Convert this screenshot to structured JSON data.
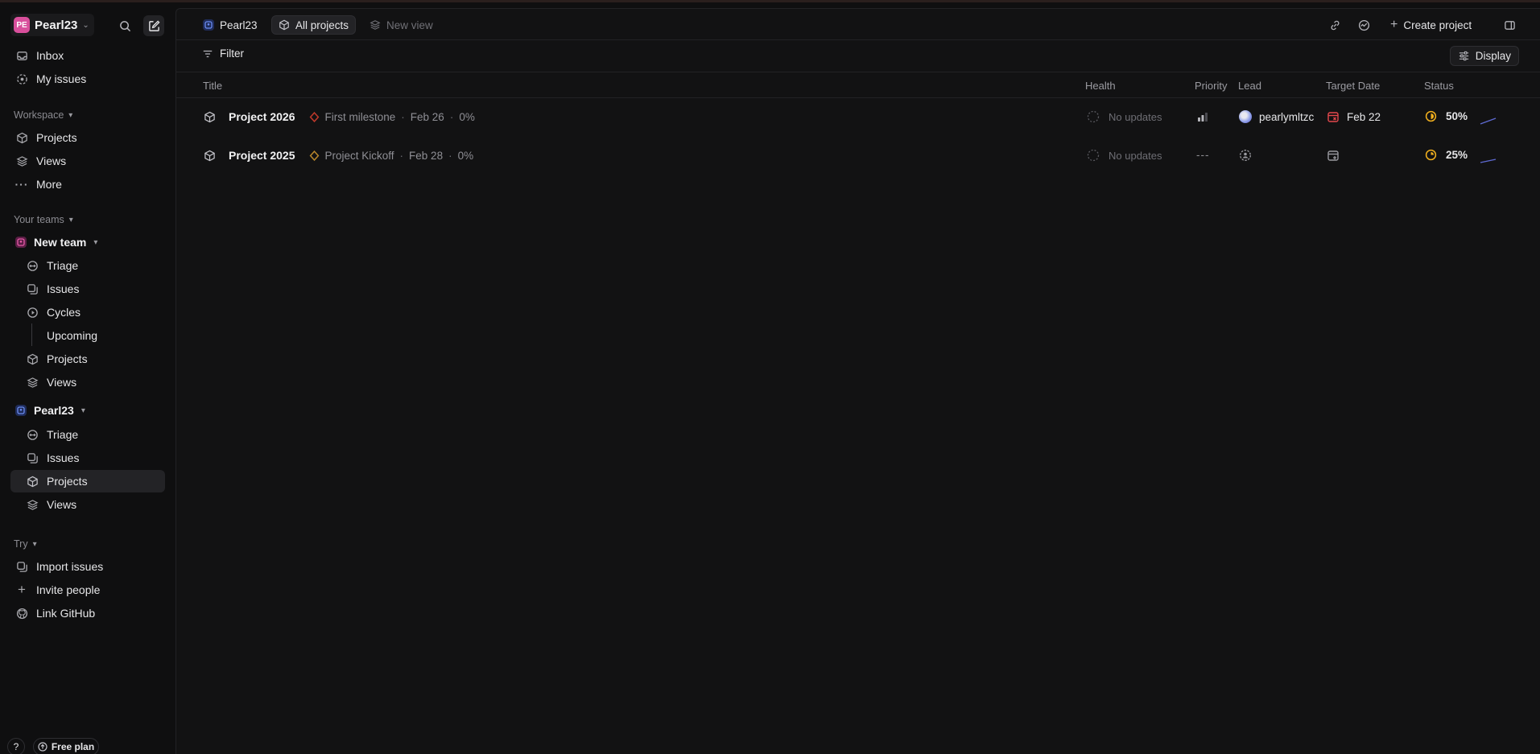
{
  "workspace": {
    "badge": "PE",
    "name": "Pearl23"
  },
  "sidebar": {
    "top_items": [
      {
        "label": "Inbox",
        "icon": "inbox-icon"
      },
      {
        "label": "My issues",
        "icon": "my-issues-icon"
      }
    ],
    "workspace_section": {
      "label": "Workspace",
      "items": [
        {
          "label": "Projects",
          "icon": "cube-icon"
        },
        {
          "label": "Views",
          "icon": "layers-icon"
        },
        {
          "label": "More",
          "icon": "more-icon"
        }
      ]
    },
    "teams_section": {
      "label": "Your teams"
    },
    "team1": {
      "name": "New team",
      "color": "#d94f9c",
      "items": [
        "Triage",
        "Issues",
        "Cycles",
        "Upcoming",
        "Projects",
        "Views"
      ]
    },
    "team2": {
      "name": "Pearl23",
      "color": "#4a6fd6",
      "items": [
        "Triage",
        "Issues",
        "Projects",
        "Views"
      ]
    },
    "try_section": {
      "label": "Try",
      "items": [
        {
          "label": "Import issues",
          "icon": "import-icon"
        },
        {
          "label": "Invite people",
          "icon": "plus-icon"
        },
        {
          "label": "Link GitHub",
          "icon": "github-icon"
        }
      ]
    },
    "footer": {
      "help": "?",
      "plan": "Free plan"
    }
  },
  "topbar": {
    "crumbs": [
      "Pearl23",
      "All projects",
      "New view"
    ],
    "create_label": "Create project"
  },
  "filterbar": {
    "filter_label": "Filter",
    "display_label": "Display"
  },
  "table": {
    "columns": [
      "Title",
      "Health",
      "Priority",
      "Lead",
      "Target Date",
      "Status"
    ],
    "rows": [
      {
        "title": "Project 2026",
        "milestone": "First milestone",
        "milestone_color": "#c0392b",
        "milestone_date": "Feb 26",
        "milestone_progress": "0%",
        "health": "No updates",
        "priority": "bars",
        "lead": "pearlymltzc",
        "target_date": "Feb 22",
        "status": "50%",
        "status_fraction": 0.5
      },
      {
        "title": "Project 2025",
        "milestone": "Project Kickoff",
        "milestone_color": "#b8862b",
        "milestone_date": "Feb 28",
        "milestone_progress": "0%",
        "health": "No updates",
        "priority": "---",
        "lead": "",
        "target_date": "",
        "status": "25%",
        "status_fraction": 0.25
      }
    ]
  },
  "colors": {
    "accent": "#5e6ad2",
    "status": "#f2b01e",
    "overdue": "#e5484d"
  }
}
